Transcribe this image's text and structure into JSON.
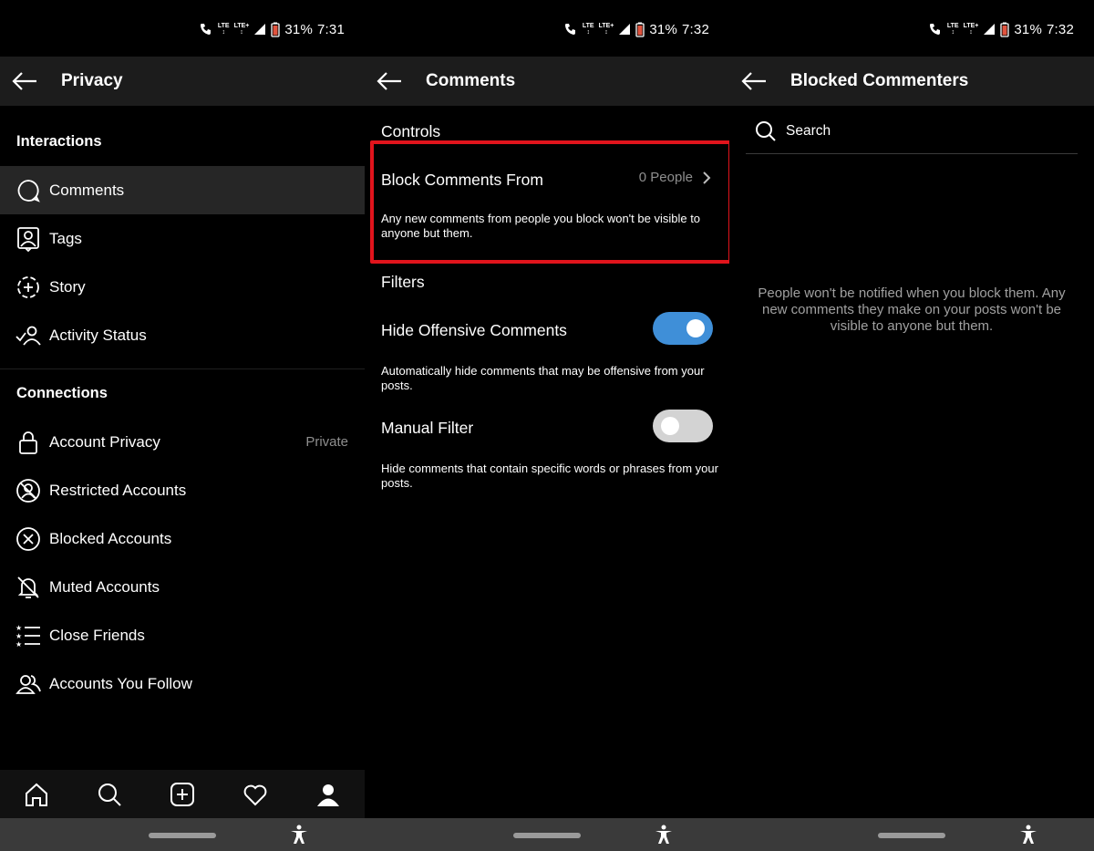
{
  "panels": [
    {
      "status": {
        "battery": "31%",
        "time": "7:31"
      },
      "title": "Privacy",
      "interactions_header": "Interactions",
      "interactions": [
        {
          "label": "Comments",
          "icon": "comment-icon",
          "active": true
        },
        {
          "label": "Tags",
          "icon": "tag-icon"
        },
        {
          "label": "Story",
          "icon": "story-icon"
        },
        {
          "label": "Activity Status",
          "icon": "activity-status-icon"
        }
      ],
      "connections_header": "Connections",
      "connections": [
        {
          "label": "Account Privacy",
          "icon": "lock-icon",
          "value": "Private"
        },
        {
          "label": "Restricted Accounts",
          "icon": "restricted-icon"
        },
        {
          "label": "Blocked Accounts",
          "icon": "blocked-icon"
        },
        {
          "label": "Muted Accounts",
          "icon": "muted-bell-icon"
        },
        {
          "label": "Close Friends",
          "icon": "close-friends-icon"
        },
        {
          "label": "Accounts You Follow",
          "icon": "following-icon"
        }
      ],
      "bottom_nav": [
        "home-icon",
        "search-icon",
        "add-post-icon",
        "heart-icon",
        "profile-icon"
      ]
    },
    {
      "status": {
        "battery": "31%",
        "time": "7:32"
      },
      "title": "Comments",
      "controls_header": "Controls",
      "block_comments": {
        "label": "Block Comments From",
        "value": "0 People",
        "description": "Any new comments from people you block won't be visible to anyone but them."
      },
      "filters_header": "Filters",
      "hide_offensive": {
        "label": "Hide Offensive Comments",
        "enabled": true,
        "description": "Automatically hide comments that may be offensive from your posts."
      },
      "manual_filter": {
        "label": "Manual Filter",
        "enabled": false,
        "description": "Hide comments that contain specific words or phrases from your posts."
      }
    },
    {
      "status": {
        "battery": "31%",
        "time": "7:32"
      },
      "title": "Blocked Commenters",
      "search_placeholder": "Search",
      "empty_message": "People won't be notified when you block them. Any new comments they make on your posts won't be visible to anyone but them."
    }
  ],
  "colors": {
    "background": "#000000",
    "appbar": "#1c1c1c",
    "toggle_on": "#3f8fd8",
    "highlight_border": "#e1141c",
    "secondary_text": "#8e8e8e"
  }
}
